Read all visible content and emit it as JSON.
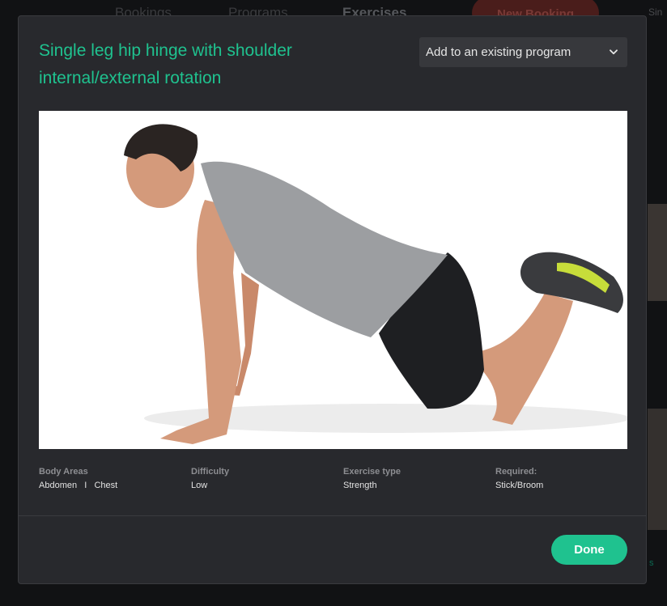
{
  "background": {
    "nav_tabs": [
      "Bookings",
      "Programs",
      "Exercises"
    ],
    "new_booking_label": "New Booking",
    "corner_text": "Sin"
  },
  "modal": {
    "title": "Single leg hip hinge with shoulder internal/external rotation",
    "program_select": {
      "selected": "Add to an existing program",
      "icon": "chevron-down-icon"
    },
    "image": {
      "alt": "Man on hands and knees with feet raised performing the exercise",
      "bg_color": "#ffffff"
    },
    "details": [
      {
        "label": "Body Areas",
        "value": "Abdomen   I   Chest"
      },
      {
        "label": "Difficulty",
        "value": "Low"
      },
      {
        "label": "Exercise type",
        "value": "Strength"
      },
      {
        "label": "Required:",
        "value": "Stick/Broom"
      }
    ],
    "done_label": "Done"
  },
  "colors": {
    "accent": "#1fc28f",
    "modal_bg": "#28292d",
    "page_bg": "#111214",
    "muted_text": "#8d8e92"
  }
}
